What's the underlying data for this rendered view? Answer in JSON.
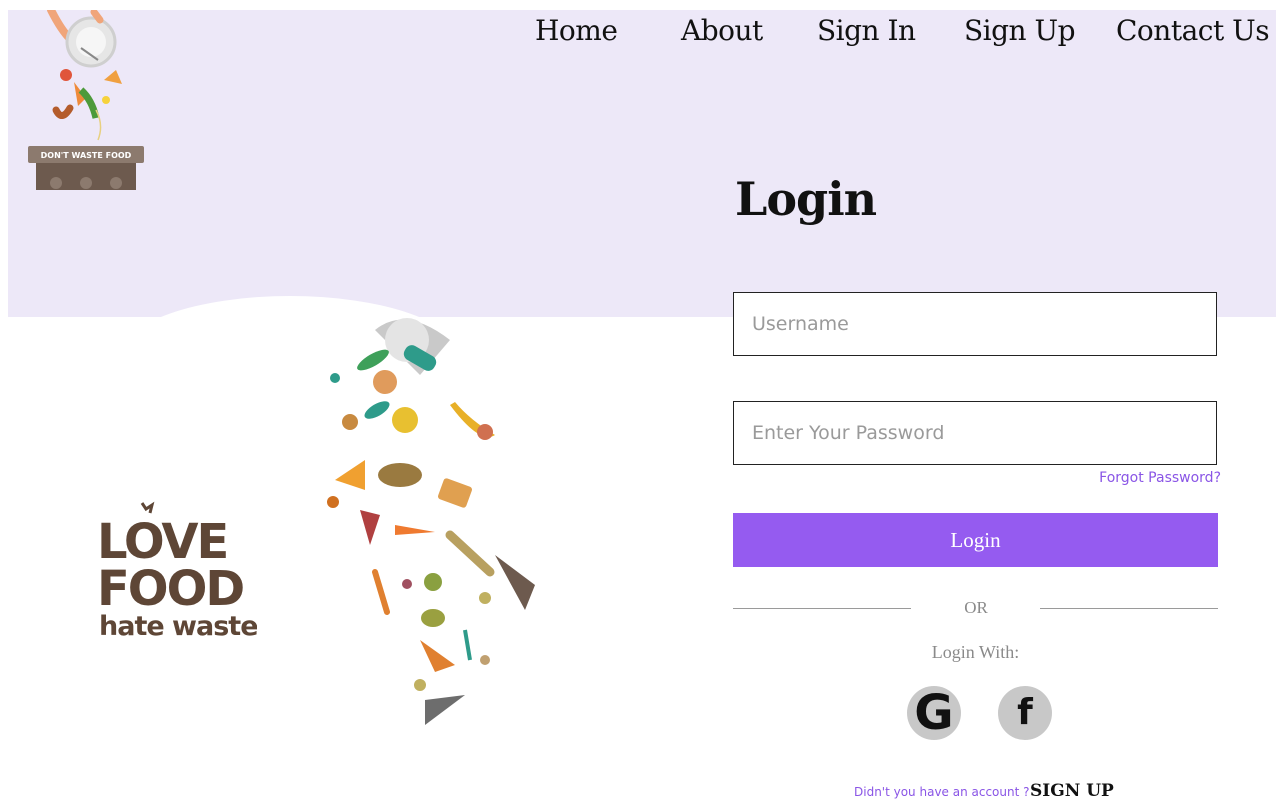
{
  "nav": {
    "home": "Home",
    "about": "About",
    "sign_in": "Sign In",
    "sign_up": "Sign Up",
    "contact": "Contact Us"
  },
  "brand": {
    "sign_text": "DON'T WASTE FOOD"
  },
  "left_logo": {
    "line1": "LOVE",
    "line2": "FOOD",
    "line3": "hate waste"
  },
  "login": {
    "title": "Login",
    "username_placeholder": "Username",
    "password_placeholder": "Enter Your Password",
    "forgot": "Forgot Password?",
    "button": "Login",
    "or": "OR",
    "login_with": "Login With:",
    "no_account": "Didn't you have an account ?",
    "sign_up": "SIGN UP"
  },
  "social": {
    "google": "G",
    "facebook": "f"
  },
  "colors": {
    "header_band": "#ede8f8",
    "accent": "#955bf0",
    "link": "#8a55e6",
    "logo_brown": "#5e4636"
  }
}
